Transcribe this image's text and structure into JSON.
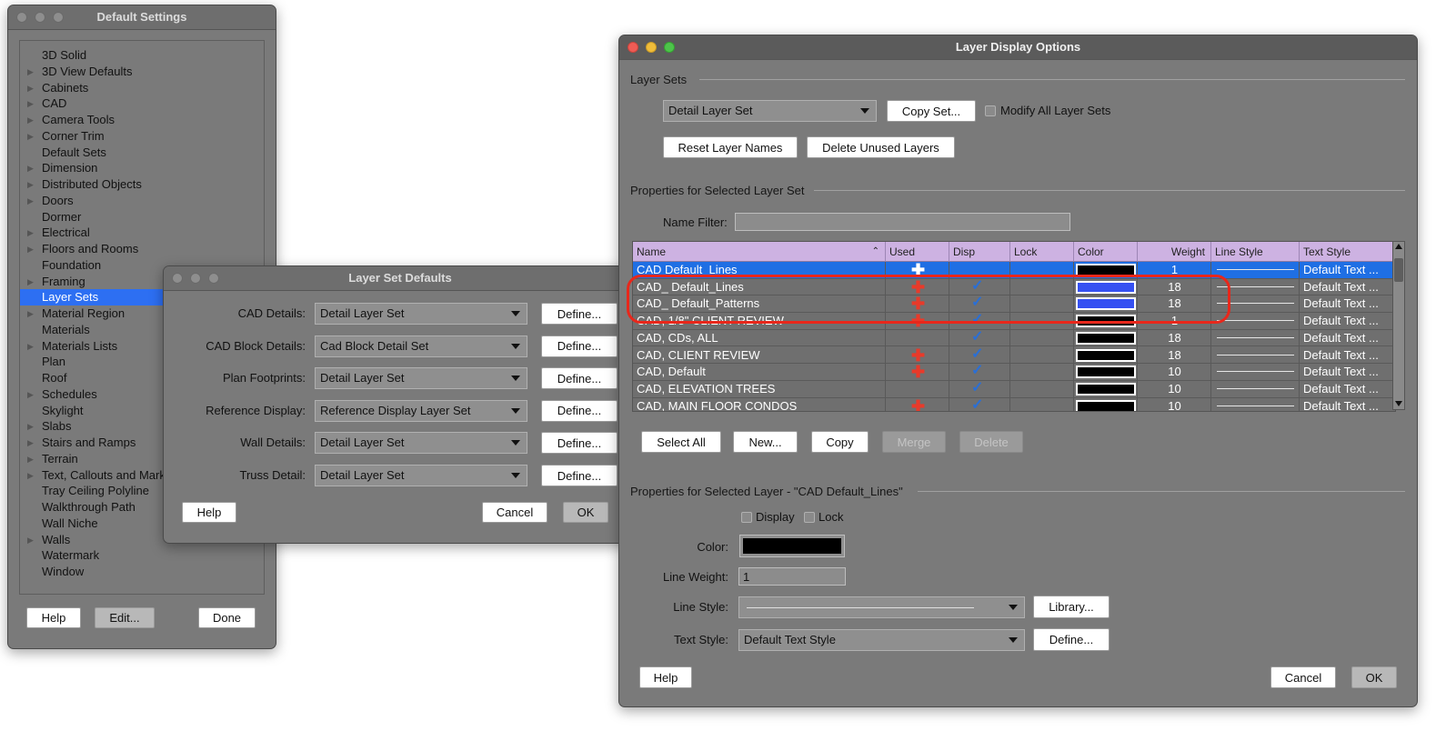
{
  "default_settings": {
    "title": "Default Settings",
    "items": [
      {
        "label": "3D Solid",
        "arrow": false
      },
      {
        "label": "3D View Defaults",
        "arrow": true
      },
      {
        "label": "Cabinets",
        "arrow": true
      },
      {
        "label": "CAD",
        "arrow": true
      },
      {
        "label": "Camera Tools",
        "arrow": true
      },
      {
        "label": "Corner Trim",
        "arrow": true
      },
      {
        "label": "Default Sets",
        "arrow": false
      },
      {
        "label": "Dimension",
        "arrow": true
      },
      {
        "label": "Distributed Objects",
        "arrow": true
      },
      {
        "label": "Doors",
        "arrow": true
      },
      {
        "label": "Dormer",
        "arrow": false
      },
      {
        "label": "Electrical",
        "arrow": true
      },
      {
        "label": "Floors and Rooms",
        "arrow": true
      },
      {
        "label": "Foundation",
        "arrow": false
      },
      {
        "label": "Framing",
        "arrow": true
      },
      {
        "label": "Layer Sets",
        "arrow": false,
        "selected": true
      },
      {
        "label": "Material Region",
        "arrow": true
      },
      {
        "label": "Materials",
        "arrow": false
      },
      {
        "label": "Materials Lists",
        "arrow": true
      },
      {
        "label": "Plan",
        "arrow": false
      },
      {
        "label": "Roof",
        "arrow": false
      },
      {
        "label": "Schedules",
        "arrow": true
      },
      {
        "label": "Skylight",
        "arrow": false
      },
      {
        "label": "Slabs",
        "arrow": true
      },
      {
        "label": "Stairs and Ramps",
        "arrow": true
      },
      {
        "label": "Terrain",
        "arrow": true
      },
      {
        "label": "Text, Callouts and Mark",
        "arrow": true
      },
      {
        "label": "Tray Ceiling Polyline",
        "arrow": false
      },
      {
        "label": "Walkthrough Path",
        "arrow": false
      },
      {
        "label": "Wall Niche",
        "arrow": false
      },
      {
        "label": "Walls",
        "arrow": true
      },
      {
        "label": "Watermark",
        "arrow": false
      },
      {
        "label": "Window",
        "arrow": false
      }
    ],
    "help_label": "Help",
    "edit_label": "Edit...",
    "done_label": "Done"
  },
  "layer_set_defaults": {
    "title": "Layer Set Defaults",
    "rows": [
      {
        "label": "CAD Details:",
        "value": "Detail Layer Set",
        "button": "Define..."
      },
      {
        "label": "CAD Block Details:",
        "value": "Cad Block Detail Set",
        "button": "Define..."
      },
      {
        "label": "Plan Footprints:",
        "value": "Detail Layer Set",
        "button": "Define..."
      },
      {
        "label": "Reference Display:",
        "value": "Reference Display Layer Set",
        "button": "Define..."
      },
      {
        "label": "Wall Details:",
        "value": "Detail Layer Set",
        "button": "Define..."
      },
      {
        "label": "Truss Detail:",
        "value": "Detail Layer Set",
        "button": "Define..."
      }
    ],
    "help_label": "Help",
    "cancel_label": "Cancel",
    "ok_label": "OK"
  },
  "layer_display": {
    "title": "Layer Display Options",
    "layer_sets_heading": "Layer Sets",
    "layer_set_value": "Detail Layer Set",
    "copy_set_label": "Copy Set...",
    "modify_all_label": "Modify All Layer Sets",
    "reset_names_label": "Reset Layer Names",
    "delete_unused_label": "Delete Unused Layers",
    "props_set_heading": "Properties for Selected Layer Set",
    "name_filter_label": "Name Filter:",
    "name_filter_value": "",
    "columns": [
      "Name",
      "Used",
      "Disp",
      "Lock",
      "Color",
      "Weight",
      "Line Style",
      "Text Style"
    ],
    "rows": [
      {
        "name": "CAD Default_Lines",
        "used": true,
        "disp": false,
        "color": "#000000",
        "weight": "1",
        "text_style": "Default Text ...",
        "selected": true
      },
      {
        "name": "CAD_  Default_Lines",
        "used": true,
        "disp": true,
        "color": "#3550f2",
        "weight": "18",
        "text_style": "Default Text ..."
      },
      {
        "name": "CAD_  Default_Patterns",
        "used": true,
        "disp": true,
        "color": "#3550f2",
        "weight": "18",
        "text_style": "Default Text ..."
      },
      {
        "name": "CAD,  1/8\"  CLIENT REVIEW",
        "used": true,
        "disp": true,
        "color": "#000000",
        "weight": "1",
        "text_style": "Default Text ..."
      },
      {
        "name": "CAD,  CDs, ALL",
        "used": false,
        "disp": true,
        "color": "#000000",
        "weight": "18",
        "text_style": "Default Text ..."
      },
      {
        "name": "CAD,  CLIENT REVIEW",
        "used": true,
        "disp": true,
        "color": "#000000",
        "weight": "18",
        "text_style": "Default Text ..."
      },
      {
        "name": "CAD,  Default",
        "used": true,
        "disp": true,
        "color": "#000000",
        "weight": "10",
        "text_style": "Default Text ..."
      },
      {
        "name": "CAD,  ELEVATION TREES",
        "used": false,
        "disp": true,
        "color": "#000000",
        "weight": "10",
        "text_style": "Default Text ..."
      },
      {
        "name": "CAD,  MAIN FLOOR CONDOS",
        "used": true,
        "disp": true,
        "color": "#000000",
        "weight": "10",
        "text_style": "Default Text ..."
      }
    ],
    "select_all_label": "Select All",
    "new_label": "New...",
    "copy_label": "Copy",
    "merge_label": "Merge",
    "delete_label": "Delete",
    "props_layer_heading": "Properties for Selected Layer - \"CAD Default_Lines\"",
    "display_label": "Display",
    "lock_label": "Lock",
    "color_label": "Color:",
    "line_weight_label": "Line Weight:",
    "line_weight_value": "1",
    "line_style_label": "Line Style:",
    "library_label": "Library...",
    "text_style_label": "Text Style:",
    "text_style_value": "Default Text Style",
    "define_label": "Define...",
    "help_label": "Help",
    "cancel_label": "Cancel",
    "ok_label": "OK",
    "highlight_color": "#e8271b"
  }
}
